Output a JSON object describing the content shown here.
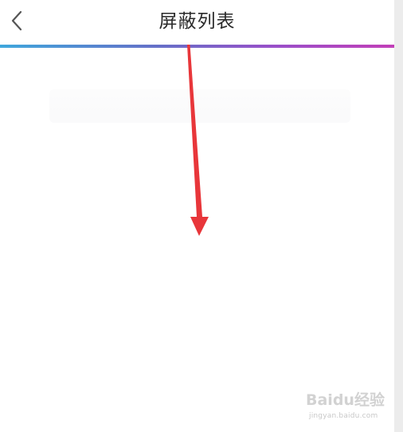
{
  "header": {
    "title": "屏蔽列表",
    "back_icon": "chevron-left-icon"
  },
  "colors": {
    "gradient_start": "#3fa7dc",
    "gradient_mid": "#9a4fc9",
    "gradient_end": "#c23fb8",
    "arrow": "#e8363a",
    "title_text": "#2a2a2a"
  },
  "watermark": {
    "brand": "Baidu经验",
    "domain": "jingyan.baidu.com"
  }
}
